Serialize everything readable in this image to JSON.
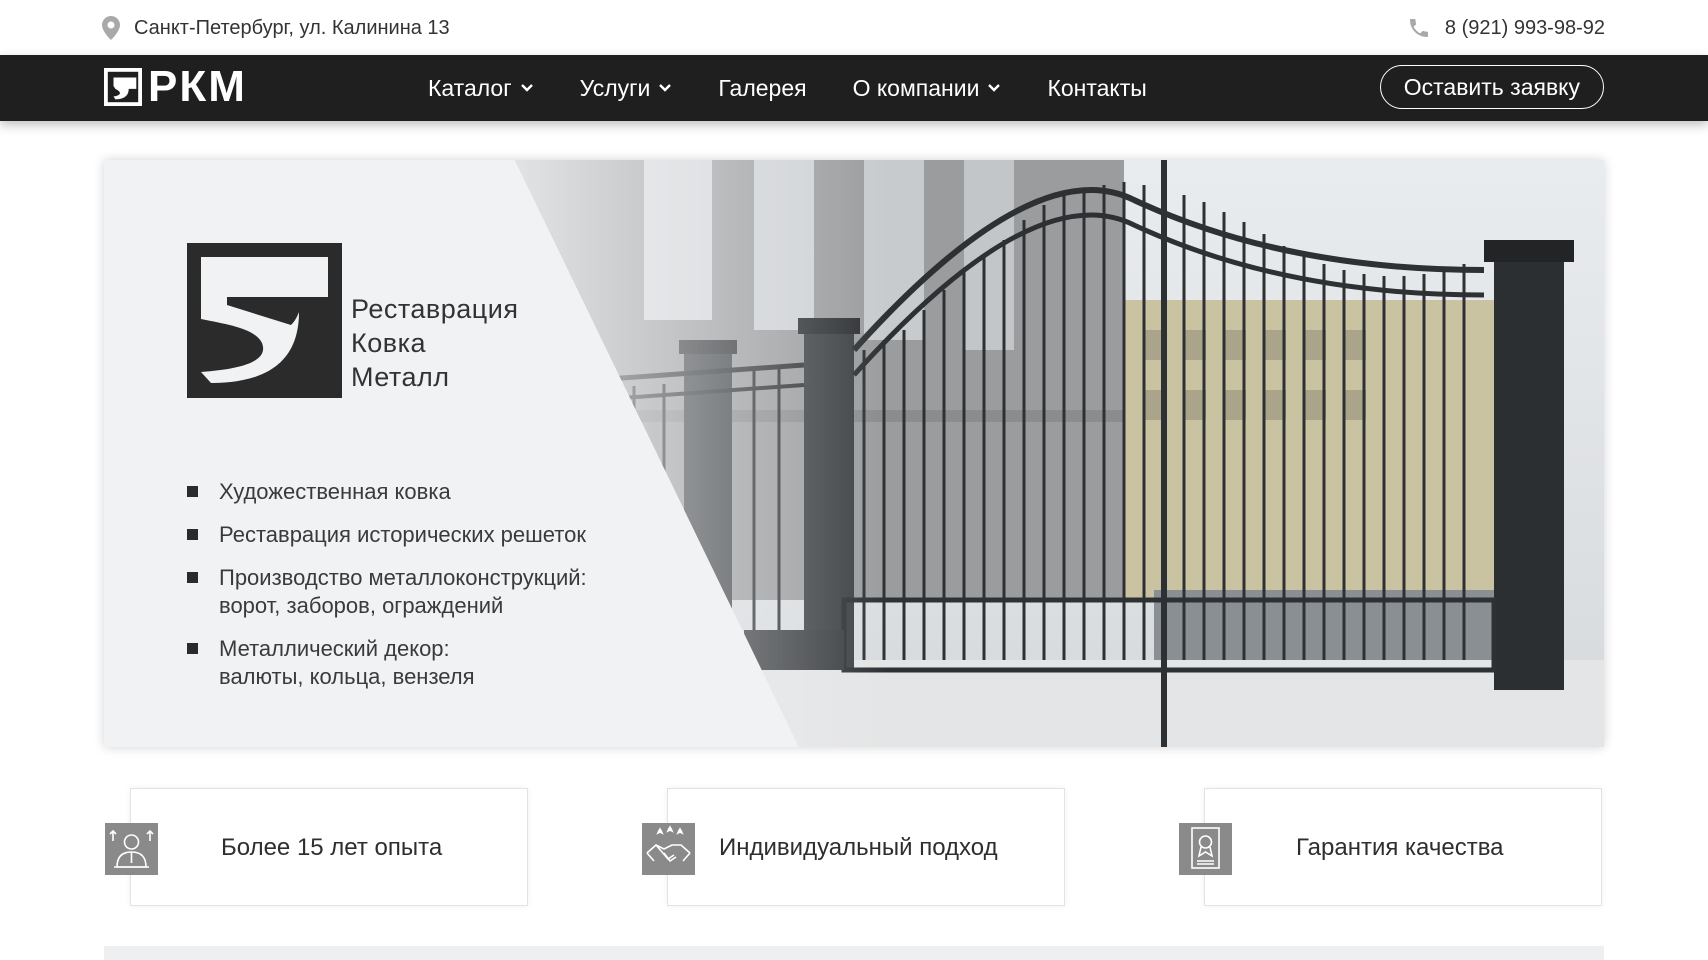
{
  "topbar": {
    "address": "Санкт-Петербург, ул. Калинина 13",
    "address_icon": "map-pin-icon",
    "phone": "8 (921) 993-98-92",
    "phone_icon": "phone-icon"
  },
  "nav": {
    "logo_text": "РКМ",
    "items": [
      {
        "label": "Каталог",
        "has_dropdown": true
      },
      {
        "label": "Услуги",
        "has_dropdown": true
      },
      {
        "label": "Галерея",
        "has_dropdown": false
      },
      {
        "label": "О компании",
        "has_dropdown": true
      },
      {
        "label": "Контакты",
        "has_dropdown": false
      }
    ],
    "cta_label": "Оставить заявку"
  },
  "hero": {
    "brand_lines": [
      "Реставрация",
      "Ковка",
      "Металл"
    ],
    "services": [
      [
        "Художественная ковка"
      ],
      [
        "Реставрация исторических решеток"
      ],
      [
        "Производство металлоконструкций:",
        "ворот, заборов, ограждений"
      ],
      [
        "Металлический декор:",
        "валюты, кольца, вензеля"
      ]
    ]
  },
  "features": [
    {
      "label": "Более 15 лет опыта",
      "icon": "expert-icon"
    },
    {
      "label": "Индивидуальный подход",
      "icon": "handshake-icon"
    },
    {
      "label": "Гарантия качества",
      "icon": "certificate-icon"
    }
  ],
  "colors": {
    "nav_bg": "#1f1f1f",
    "hero_bg": "#f1f2f4",
    "icon_bg": "#8a8a8a",
    "text": "#2b2b2b"
  }
}
